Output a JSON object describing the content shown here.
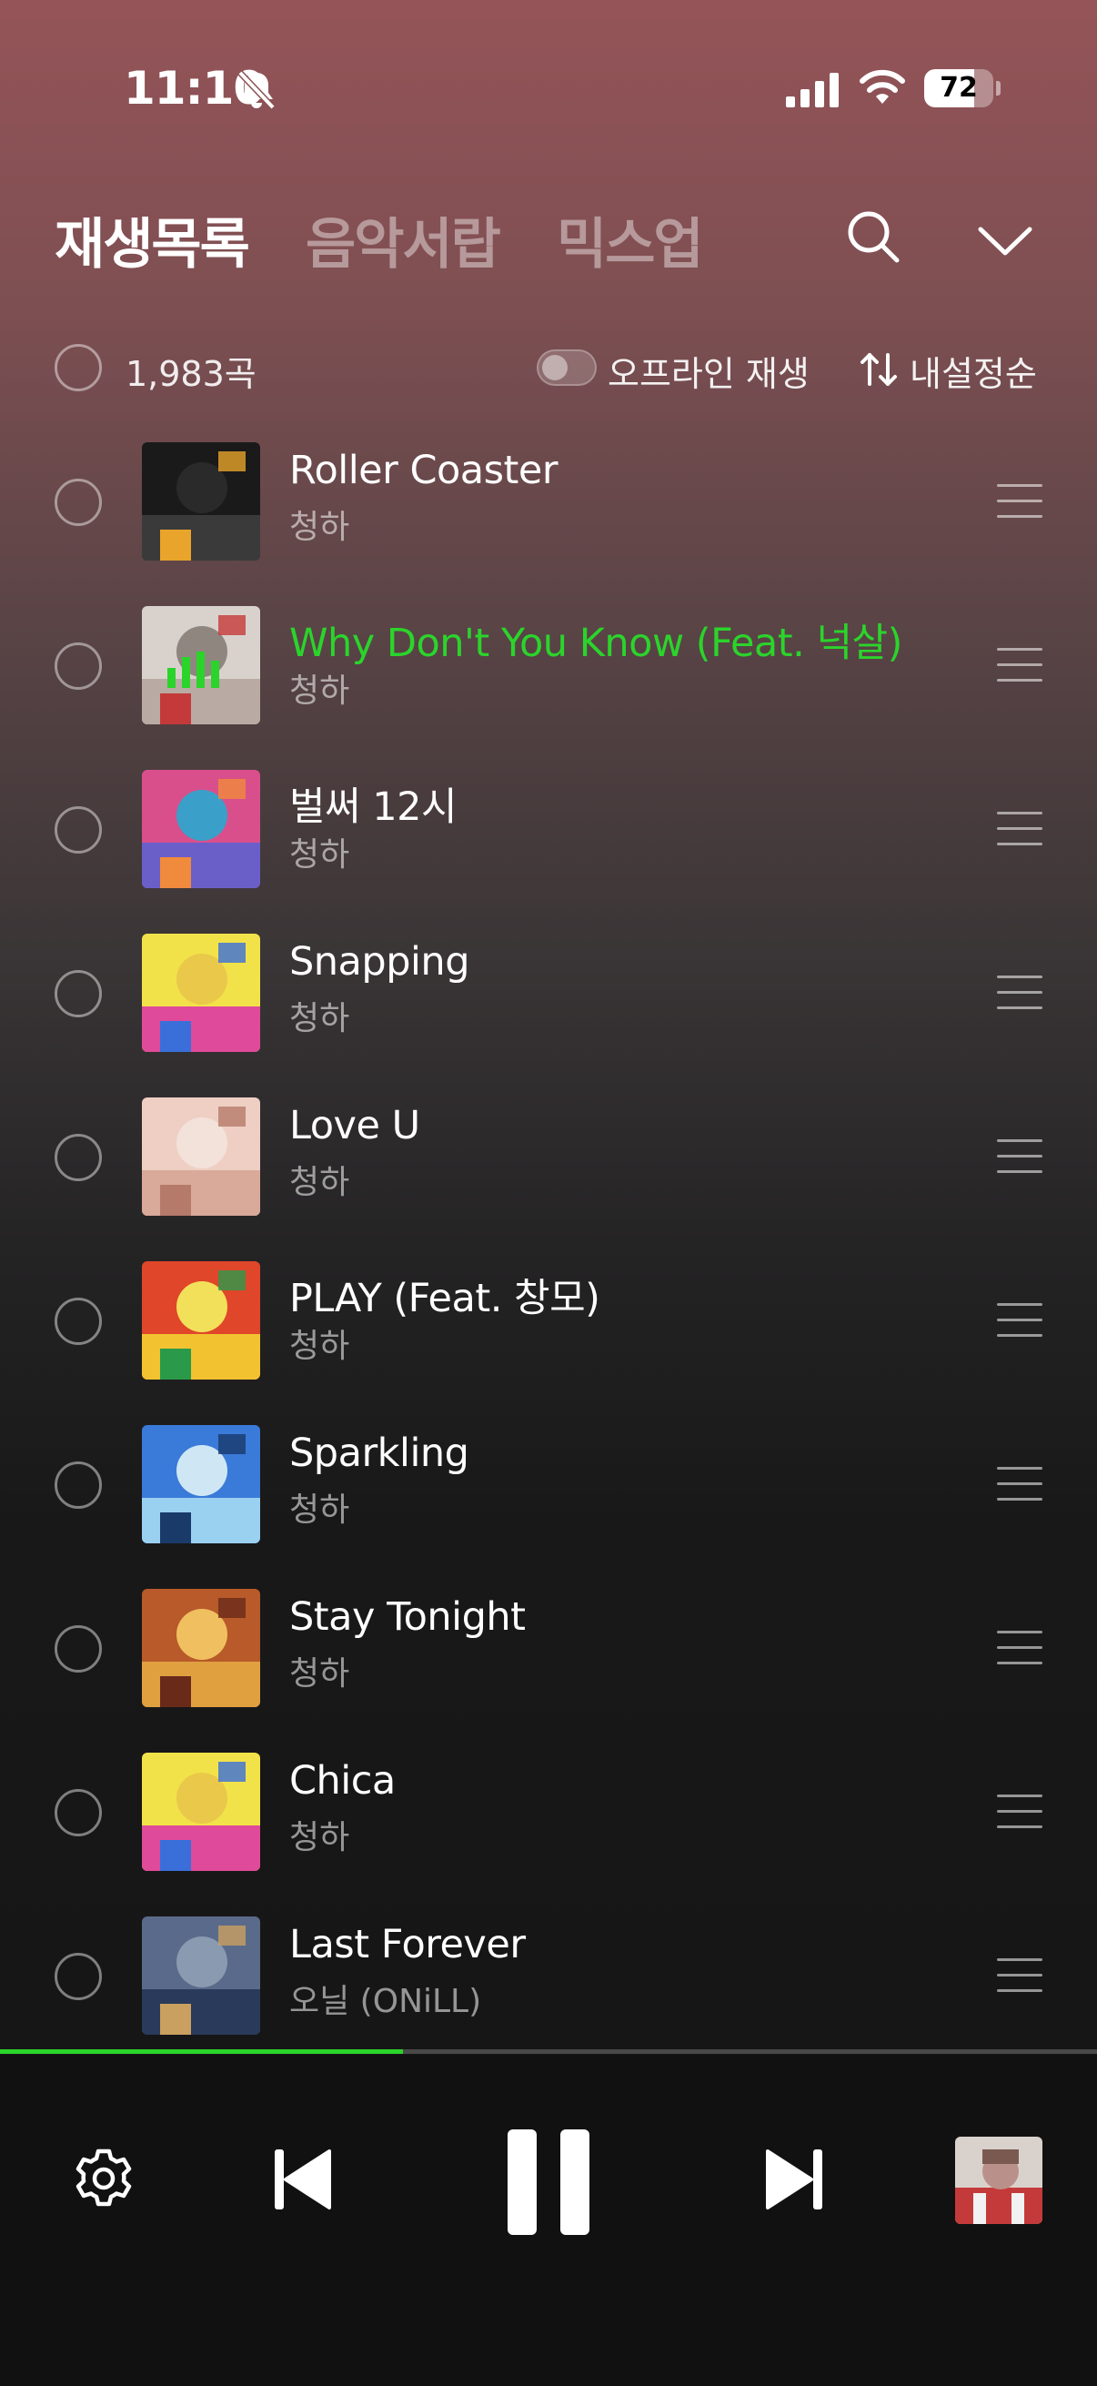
{
  "status_bar": {
    "time": "11:10",
    "battery": 72,
    "battery_label": "72"
  },
  "header": {
    "tabs": [
      {
        "label": "재생목록",
        "active": true
      },
      {
        "label": "음악서랍",
        "active": false
      },
      {
        "label": "믹스업",
        "active": false
      }
    ]
  },
  "toolbar": {
    "count": "1,983곡",
    "offline_label": "오프라인 재생",
    "offline_enabled": false,
    "sort_label": "내설정순"
  },
  "tracks": [
    {
      "title": "Roller Coaster",
      "artist": "청하",
      "playing": false,
      "art_colors": [
        "#1a1a1a",
        "#3a3a3a",
        "#e8a42b",
        "#2a2a2a"
      ]
    },
    {
      "title": "Why Don't You Know (Feat. 넉살)",
      "artist": "청하",
      "playing": true,
      "art_colors": [
        "#d9d2cc",
        "#b9aaa3",
        "#c43a3a",
        "#8f8680"
      ]
    },
    {
      "title": "벌써 12시",
      "artist": "청하",
      "playing": false,
      "art_colors": [
        "#d94f8c",
        "#6a5fc9",
        "#f08a3c",
        "#3aa0c9"
      ]
    },
    {
      "title": "Snapping",
      "artist": "청하",
      "playing": false,
      "art_colors": [
        "#f2e24a",
        "#e04a9a",
        "#3a6fd9",
        "#e9c84a"
      ]
    },
    {
      "title": "Love U",
      "artist": "청하",
      "playing": false,
      "art_colors": [
        "#efcfc3",
        "#d9a99a",
        "#b57a6a",
        "#f3e2da"
      ]
    },
    {
      "title": "PLAY (Feat. 창모)",
      "artist": "청하",
      "playing": false,
      "art_colors": [
        "#e0462a",
        "#f2c230",
        "#2a9a4a",
        "#f3e05a"
      ]
    },
    {
      "title": "Sparkling",
      "artist": "청하",
      "playing": false,
      "art_colors": [
        "#3a7ad9",
        "#9ad0f0",
        "#1a3a6a",
        "#cfe7f5"
      ]
    },
    {
      "title": "Stay Tonight",
      "artist": "청하",
      "playing": false,
      "art_colors": [
        "#b85a2a",
        "#e0a040",
        "#6a2a1a",
        "#f0c060"
      ]
    },
    {
      "title": "Chica",
      "artist": "청하",
      "playing": false,
      "art_colors": [
        "#f2e24a",
        "#e04a9a",
        "#3a6fd9",
        "#e9c84a"
      ]
    },
    {
      "title": "Last Forever",
      "artist": "오닐 (ONiLL)",
      "playing": false,
      "art_colors": [
        "#5a6a8a",
        "#2a3a5a",
        "#c9a060",
        "#8a9ab0"
      ]
    }
  ],
  "player": {
    "progress": 0.367,
    "state": "playing"
  },
  "colors": {
    "accent": "#2bd42b",
    "now_playing_title": "#2bd42b"
  }
}
